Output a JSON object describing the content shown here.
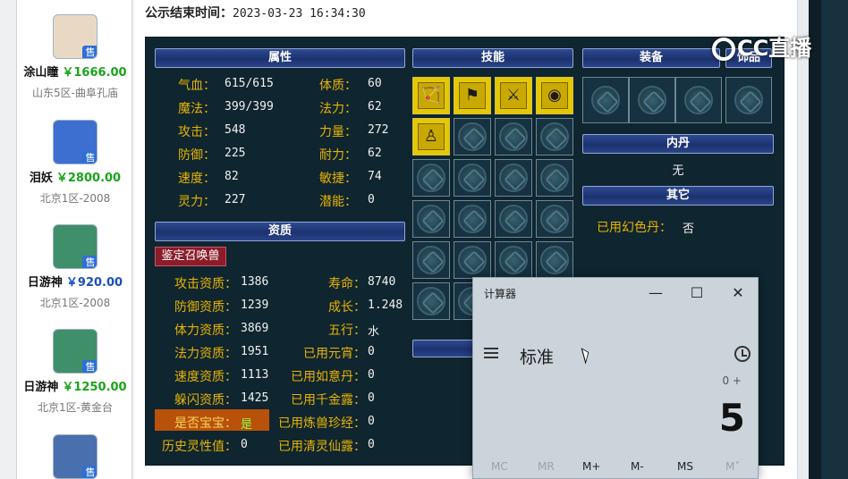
{
  "sellers": [
    {
      "name": "涂山瞳",
      "price": "￥1666.00",
      "server": "山东5区-曲阜孔庙",
      "tag": "售",
      "avatar_color": "#e9d9c4"
    },
    {
      "name": "泪妖",
      "price": "￥2800.00",
      "server": "北京1区-2008",
      "tag": "售",
      "avatar_color": "#3d6fd0"
    },
    {
      "name": "日游神",
      "price": "￥920.00",
      "server": "北京1区-2008",
      "tag": "售",
      "avatar_color": "#3f8f6a"
    },
    {
      "name": "日游神",
      "price": "￥1250.00",
      "server": "北京1区-黄金台",
      "tag": "售",
      "avatar_color": "#3f8f6a"
    },
    {
      "name": "",
      "price": "",
      "server": "",
      "tag": "售",
      "avatar_color": "#4a6fae"
    }
  ],
  "end_time": {
    "label": "公示结束时间：",
    "value": "2023-03-23 16:34:30"
  },
  "sections": {
    "attributes": "属性",
    "skills": "技能",
    "equipment": "装备",
    "ornament": "饰品",
    "inner_core": "内丹",
    "others": "其它",
    "aptitude": "资质"
  },
  "attributes": [
    {
      "label": "气血：",
      "value": "615/615"
    },
    {
      "label": "体质：",
      "value": "60"
    },
    {
      "label": "魔法：",
      "value": "399/399"
    },
    {
      "label": "法力：",
      "value": "62"
    },
    {
      "label": "攻击：",
      "value": "548"
    },
    {
      "label": "力量：",
      "value": "272"
    },
    {
      "label": "防御：",
      "value": "225"
    },
    {
      "label": "耐力：",
      "value": "62"
    },
    {
      "label": "速度：",
      "value": "82"
    },
    {
      "label": "敏捷：",
      "value": "74"
    },
    {
      "label": "灵力：",
      "value": "227"
    },
    {
      "label": "潜能：",
      "value": "0"
    }
  ],
  "appraise_button": "鉴定召唤兽",
  "aptitudes": [
    {
      "label": "攻击资质：",
      "value": "1386"
    },
    {
      "label": "寿命：",
      "value": "8740"
    },
    {
      "label": "防御资质：",
      "value": "1239"
    },
    {
      "label": "成长：",
      "value": "1.248"
    },
    {
      "label": "体力资质：",
      "value": "3869"
    },
    {
      "label": "五行：",
      "value": "水"
    },
    {
      "label": "法力资质：",
      "value": "1951"
    },
    {
      "label": "已用元宵：",
      "value": "0"
    },
    {
      "label": "速度资质：",
      "value": "1113"
    },
    {
      "label": "已用如意丹：",
      "value": "0"
    },
    {
      "label": "躲闪资质：",
      "value": "1425"
    },
    {
      "label": "已用千金露：",
      "value": "0"
    },
    {
      "label": "是否宝宝：",
      "value": "是"
    },
    {
      "label": "已用炼兽珍经：",
      "value": "0"
    },
    {
      "label": "历史灵性值：",
      "value": "0"
    },
    {
      "label": "已用清灵仙露：",
      "value": "0"
    }
  ],
  "inner_core_value": "无",
  "others": {
    "label": "已用幻色丹：",
    "value": "否"
  },
  "skill_icons": [
    "bow-skill-icon",
    "banner-skill-icon",
    "sword-skill-icon",
    "eye-skill-icon",
    "figure-skill-icon"
  ],
  "calculator": {
    "title": "计算器",
    "mode": "标准",
    "expression": "0 +",
    "display": "5",
    "memory_buttons": [
      "MC",
      "MR",
      "M+",
      "M-",
      "MS",
      "M˅"
    ],
    "minimize": "—",
    "maximize": "☐",
    "close": "✕"
  },
  "watermark": "CC直播"
}
